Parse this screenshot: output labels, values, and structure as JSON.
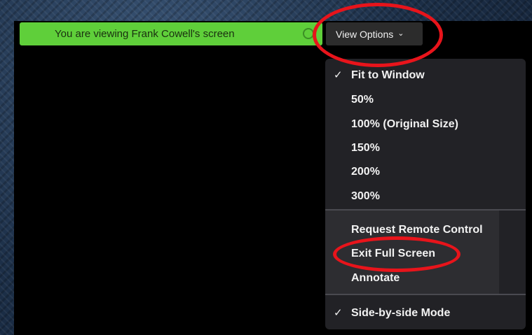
{
  "share_bar": {
    "text": "You are viewing Frank Cowell's screen",
    "color": "#5fcf3a"
  },
  "view_options": {
    "label": "View Options",
    "chevron": "⌄"
  },
  "menu": {
    "items": [
      {
        "label": "Fit to Window",
        "checked": true,
        "check": "✓"
      },
      {
        "label": "50%",
        "checked": false,
        "check": ""
      },
      {
        "label": "100% (Original Size)",
        "checked": false,
        "check": ""
      },
      {
        "label": "150%",
        "checked": false,
        "check": ""
      },
      {
        "label": "200%",
        "checked": false,
        "check": ""
      },
      {
        "label": "300%",
        "checked": false,
        "check": ""
      },
      {
        "label": "Request Remote Control",
        "checked": false,
        "check": ""
      },
      {
        "label": "Exit Full Screen",
        "checked": false,
        "check": ""
      },
      {
        "label": "Annotate",
        "checked": false,
        "check": ""
      },
      {
        "label": "Side-by-side Mode",
        "checked": true,
        "check": "✓"
      }
    ]
  },
  "colors": {
    "highlight_ring": "#e8141b",
    "menu_background": "#222226",
    "screen_background": "#000000"
  }
}
